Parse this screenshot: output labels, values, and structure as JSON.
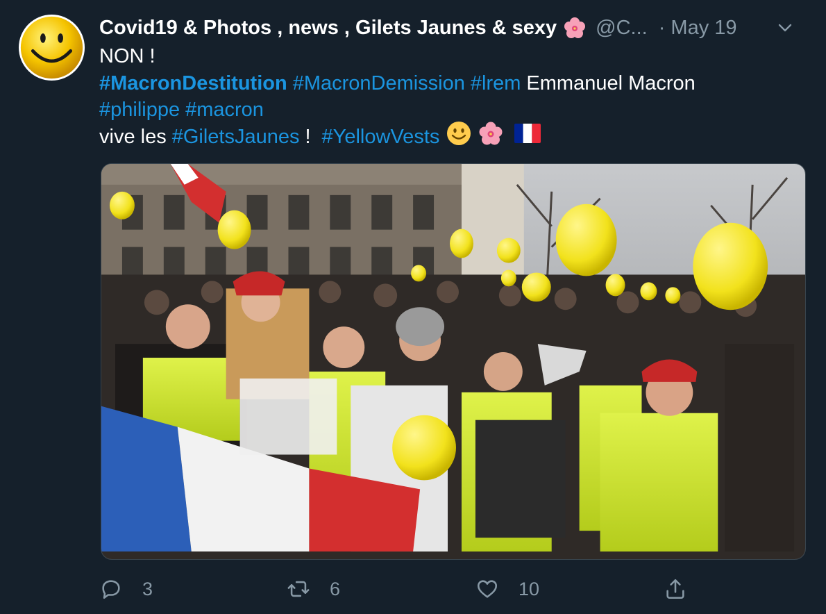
{
  "tweet": {
    "author": {
      "display_name": "Covid19 & Photos , news , Gilets Jaunes & sexy",
      "name_emoji": "hibiscus-flower",
      "handle": "@C...",
      "separator": "·",
      "date": "May 19"
    },
    "text": {
      "line1": "NON !",
      "line2": [
        {
          "text": "#MacronDestitution",
          "type": "hashtag-bold"
        },
        {
          "text": "#MacronDemission",
          "type": "hashtag"
        },
        {
          "text": "#lrem",
          "type": "hashtag"
        },
        {
          "text": "Emmanuel Macron",
          "type": "text"
        }
      ],
      "line3": [
        {
          "text": "#philippe",
          "type": "hashtag"
        },
        {
          "text": "#macron",
          "type": "hashtag"
        }
      ],
      "line4": {
        "prefix": "vive les",
        "hashtag1": "#GiletsJaunes",
        "bang": "!",
        "hashtag2": "#YellowVests",
        "emojis": [
          "smiling-face",
          "hibiscus-flower",
          "france-flag"
        ]
      }
    },
    "media": {
      "alt_description": "photo-of-yellow-vest-protesters-with-yellow-balloons-and-french-flag"
    },
    "actions": {
      "reply_count": "3",
      "retweet_count": "6",
      "like_count": "10",
      "share_icon": "share-icon"
    }
  },
  "colors": {
    "background": "#15202b",
    "text_primary": "#ffffff",
    "text_secondary": "#8899a6",
    "link": "#1b95e0"
  }
}
